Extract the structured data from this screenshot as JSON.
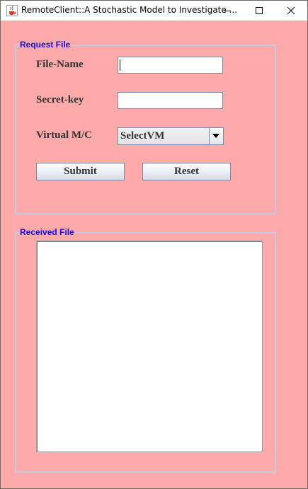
{
  "window": {
    "title": "RemoteClient::A Stochastic Model to Investigate ...",
    "icon": "java-cup-icon",
    "controls": [
      "minimize-icon",
      "maximize-icon",
      "close-icon"
    ]
  },
  "request_panel": {
    "title": "Request File",
    "file_name_label": "File-Name",
    "file_name_value": "",
    "secret_key_label": "Secret-key",
    "secret_key_value": "",
    "vm_label": "Virtual M/C",
    "vm_selected": "SelectVM",
    "submit_label": "Submit",
    "reset_label": "Reset"
  },
  "received_panel": {
    "title": "Received File",
    "content": ""
  },
  "colors": {
    "background": "#ffaaaa",
    "group_title": "#1010e0",
    "label_text": "#333333"
  }
}
